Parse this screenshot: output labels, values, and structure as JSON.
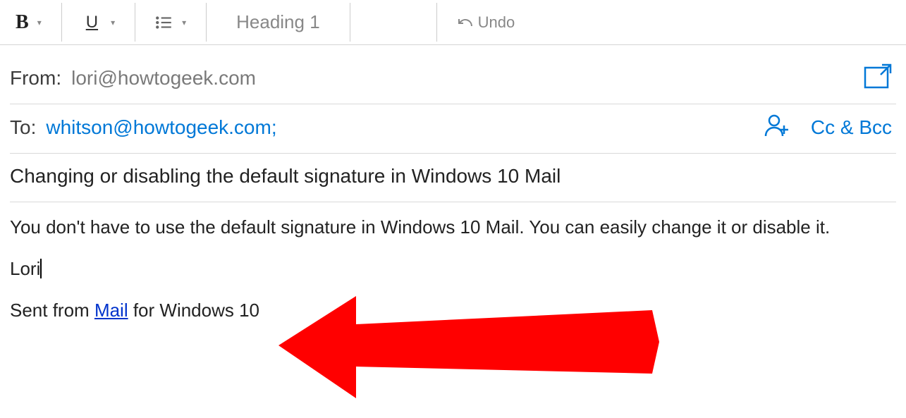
{
  "toolbar": {
    "bold_label": "B",
    "underline_label": "U",
    "heading_label": "Heading 1",
    "undo_label": "Undo"
  },
  "from": {
    "label": "From:",
    "value": "lori@howtogeek.com"
  },
  "to": {
    "label": "To:",
    "value": "whitson@howtogeek.com;",
    "ccbcc_label": "Cc & Bcc"
  },
  "subject": {
    "value": "Changing or disabling the default signature in Windows 10 Mail"
  },
  "body": {
    "para1": "You don't have to use the default signature in Windows 10 Mail. You can easily change it or disable it.",
    "name": "Lori",
    "sig_pre": "Sent from ",
    "sig_link": "Mail",
    "sig_post": " for Windows 10"
  }
}
